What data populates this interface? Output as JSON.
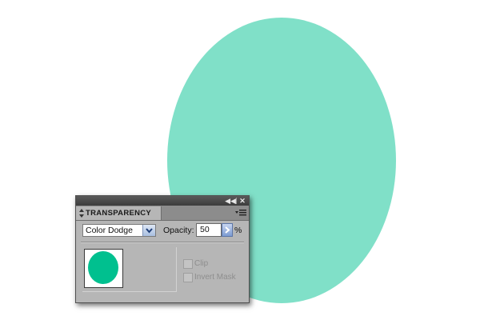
{
  "canvas": {
    "shape_color": "#80e0c8"
  },
  "panel": {
    "title": "TRANSPARENCY",
    "blend_mode": {
      "selected": "Color Dodge"
    },
    "opacity": {
      "label": "Opacity:",
      "value": "50",
      "unit": "%"
    },
    "thumbnail": {
      "shape_color": "#00c08f"
    },
    "checkboxes": [
      {
        "label": "Clip",
        "checked": false,
        "enabled": false
      },
      {
        "label": "Invert Mask",
        "checked": false,
        "enabled": false
      }
    ],
    "icons": [
      "collapse-icon",
      "close-icon",
      "panel-menu-icon",
      "tab-arrows-icon",
      "dropdown-arrow-icon",
      "stepper-arrow-icon"
    ]
  }
}
